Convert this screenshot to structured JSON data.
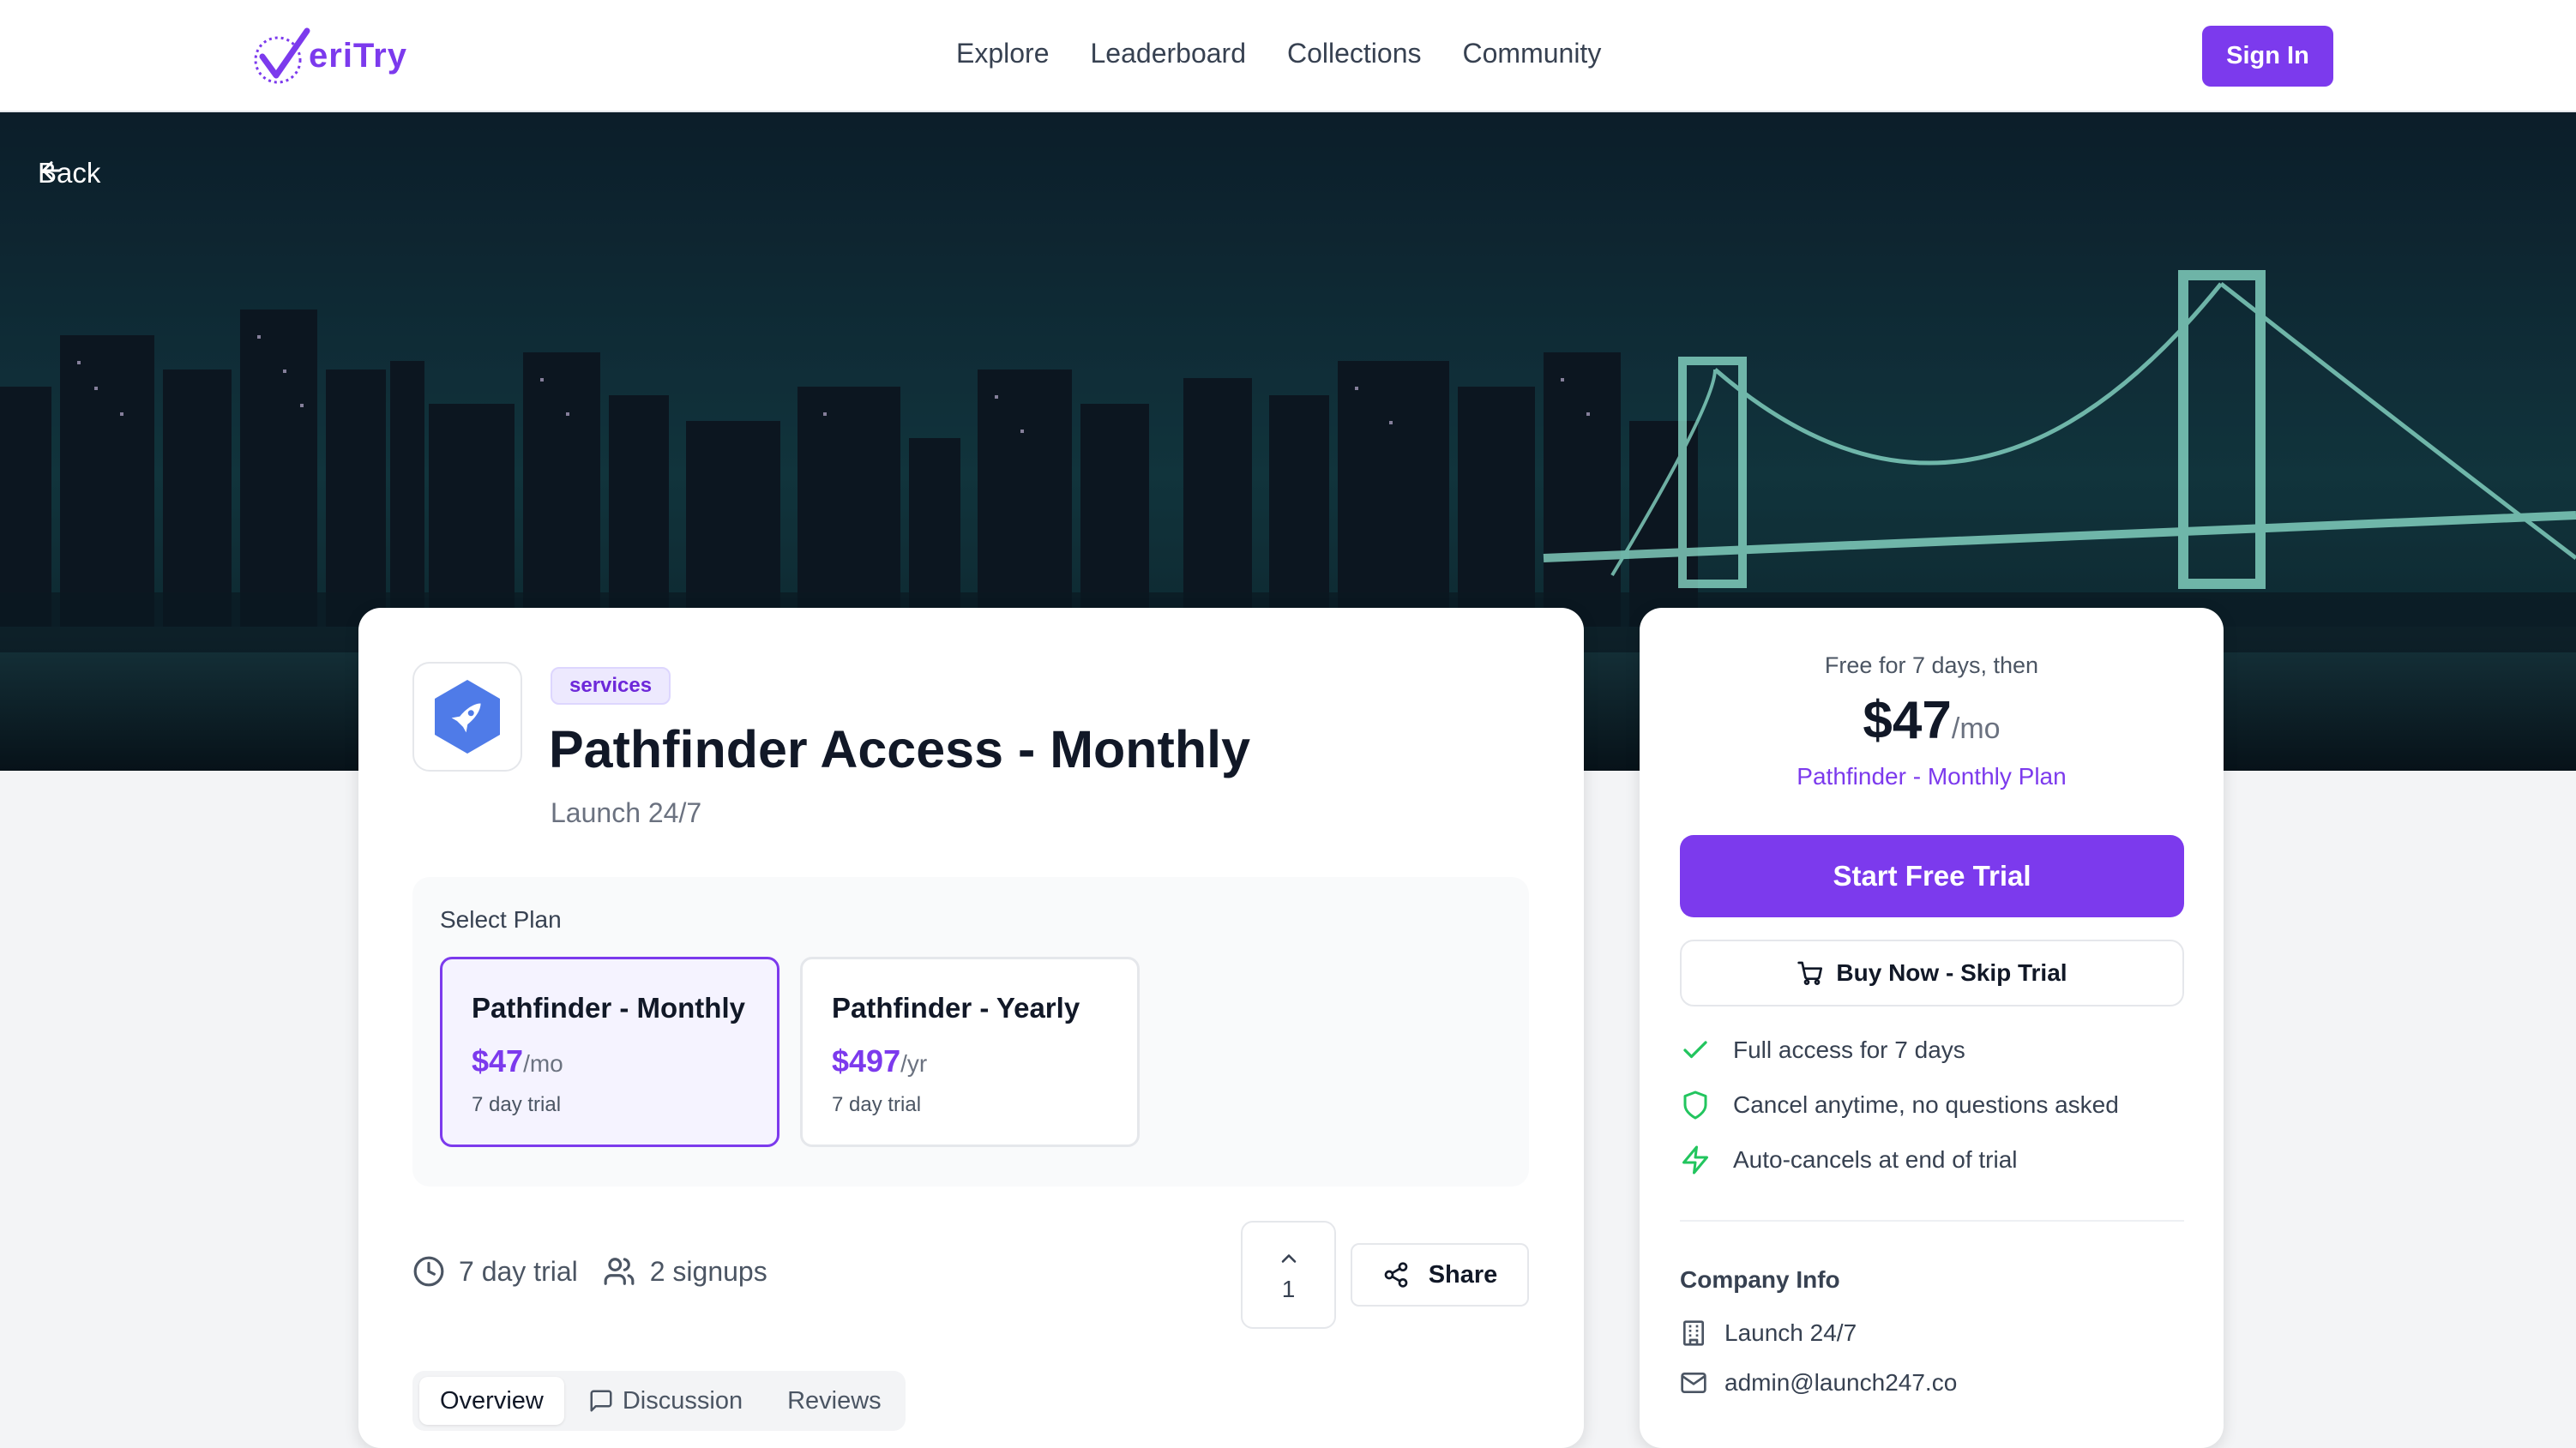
{
  "brand": {
    "name": "eriTry",
    "accent": "#7c3aed"
  },
  "nav": {
    "items": [
      "Explore",
      "Leaderboard",
      "Collections",
      "Community"
    ],
    "signin": "Sign In"
  },
  "hero": {
    "back_label": "Back"
  },
  "product": {
    "category": "services",
    "title": "Pathfinder Access - Monthly",
    "company": "Launch 24/7",
    "select_plan_label": "Select Plan",
    "plans": [
      {
        "name": "Pathfinder - Monthly",
        "price": "$47",
        "period": "/mo",
        "trial": "7 day trial",
        "selected": true
      },
      {
        "name": "Pathfinder - Yearly",
        "price": "$497",
        "period": "/yr",
        "trial": "7 day trial",
        "selected": false
      }
    ],
    "stats": {
      "trial": "7 day trial",
      "signups": "2 signups"
    },
    "upvotes": "1",
    "share_label": "Share",
    "tabs": [
      "Overview",
      "Discussion",
      "Reviews"
    ]
  },
  "sidebar": {
    "free_text": "Free for 7 days, then",
    "price": "$47",
    "period": "/mo",
    "plan_name": "Pathfinder - Monthly Plan",
    "cta": "Start Free Trial",
    "buy": "Buy Now - Skip Trial",
    "features": [
      "Full access for 7 days",
      "Cancel anytime, no questions asked",
      "Auto-cancels at end of trial"
    ],
    "company_info_label": "Company Info",
    "company_name": "Launch 24/7",
    "company_email": "admin@launch247.co"
  }
}
